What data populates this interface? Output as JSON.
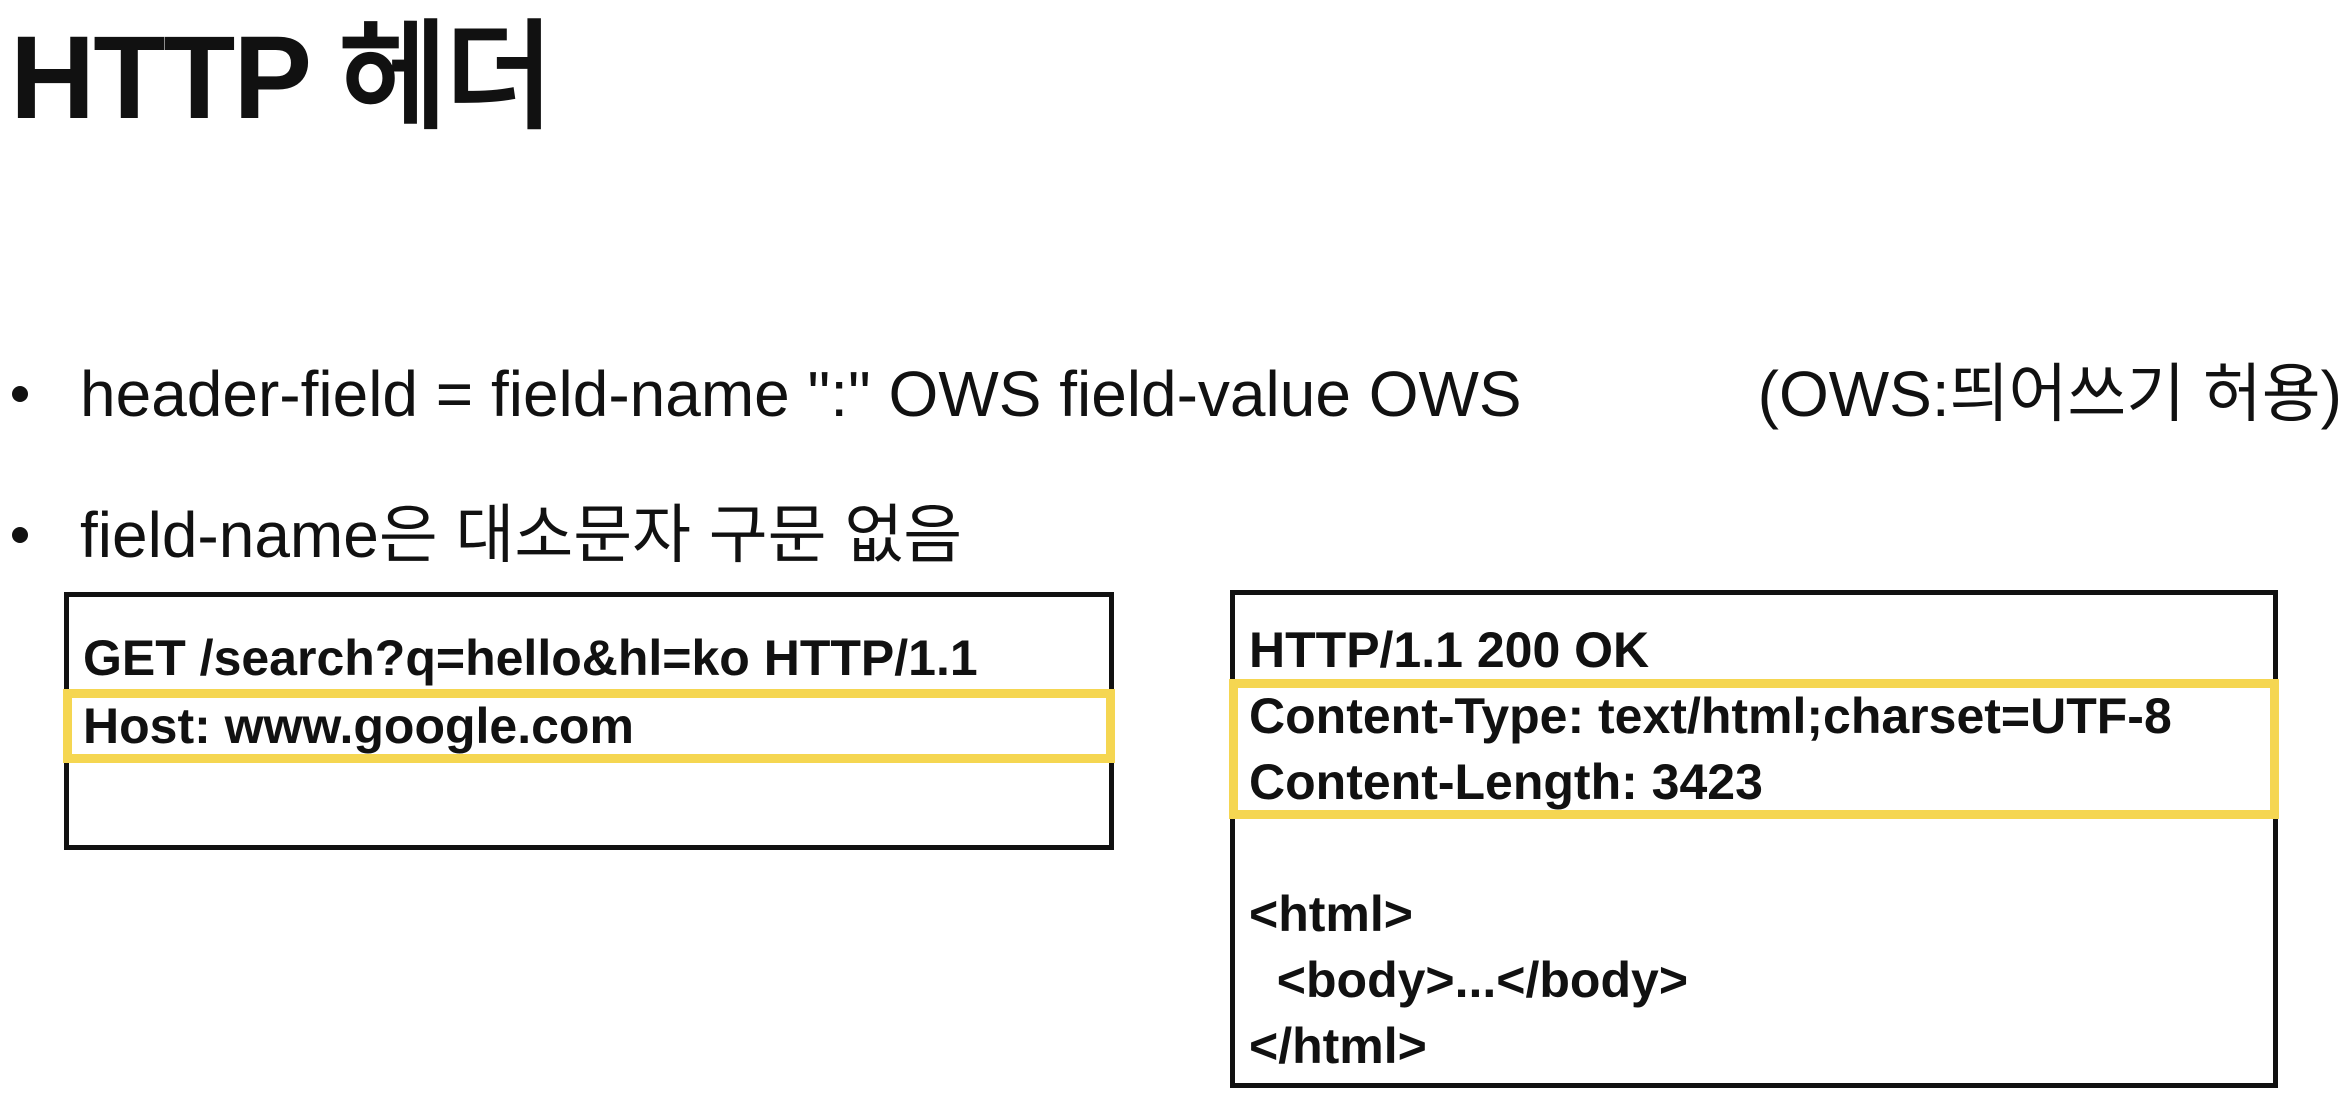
{
  "title": "HTTP 헤더",
  "bullets": [
    {
      "text": "header-field = field-name \":\" OWS field-value OWS",
      "note": "(OWS:띄어쓰기 허용)"
    },
    {
      "text": "field-name은 대소문자 구문 없음"
    }
  ],
  "request": {
    "lines": [
      "GET /search?q=hello&hl=ko HTTP/1.1",
      "Host: www.google.com"
    ]
  },
  "response": {
    "lines": [
      "HTTP/1.1 200 OK",
      "Content-Type: text/html;charset=UTF-8",
      "Content-Length: 3423",
      "",
      "<html>",
      "  <body>...</body>",
      "</html>"
    ]
  },
  "colors": {
    "highlight": "#f5d651",
    "text": "#111111",
    "border": "#111111"
  }
}
